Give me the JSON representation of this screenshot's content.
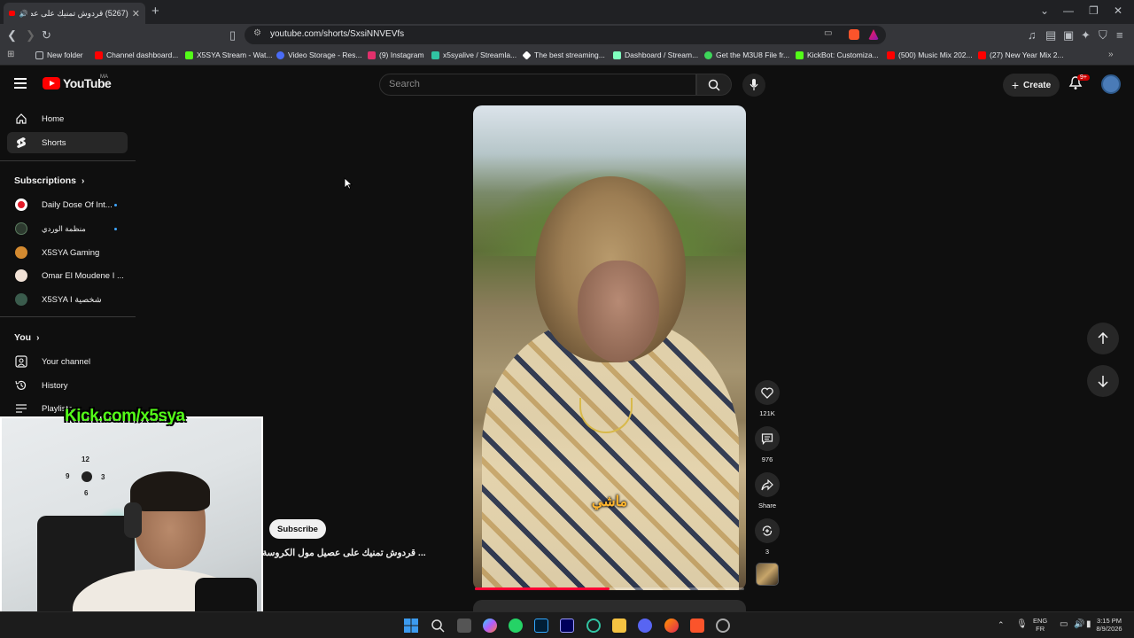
{
  "browser": {
    "tab_title": "(5267) قردوش تمنيك على عصـ",
    "new_tab": "+",
    "url": "youtube.com/shorts/SxsiNNVEVfs",
    "window_controls": [
      "⌄",
      "—",
      "❐",
      "✕"
    ],
    "bookmarks": [
      {
        "label": "New folder",
        "icon": "folder-icon",
        "color": "#bdc1c6"
      },
      {
        "label": "Channel dashboard...",
        "icon": "youtube-icon",
        "color": "#ff0000"
      },
      {
        "label": "X5SYA Stream - Wat...",
        "icon": "kick-icon",
        "color": "#53fc18"
      },
      {
        "label": "Video Storage - Res...",
        "icon": "storage-icon",
        "color": "#4a6cf7"
      },
      {
        "label": "(9) Instagram",
        "icon": "instagram-icon",
        "color": "#e1306c"
      },
      {
        "label": "x5syalive / Streamla...",
        "icon": "streamlabs-icon",
        "color": "#31c3a2"
      },
      {
        "label": "The best streaming...",
        "icon": "diamond-icon",
        "color": "#ffffff"
      },
      {
        "label": "Dashboard / Stream...",
        "icon": "dashboard-icon",
        "color": "#80ffbe"
      },
      {
        "label": "Get the M3U8 File fr...",
        "icon": "green-circle-icon",
        "color": "#3dd65a"
      },
      {
        "label": "KickBot: Customiza...",
        "icon": "kickbot-icon",
        "color": "#53fc18"
      },
      {
        "label": "(500) Music Mix 202...",
        "icon": "youtube-icon",
        "color": "#ff0000"
      },
      {
        "label": "(27) New Year Mix 2...",
        "icon": "youtube-icon",
        "color": "#ff0000"
      }
    ]
  },
  "youtube": {
    "logo_text": "YouTube",
    "country_code": "MA",
    "search_placeholder": "Search",
    "create_label": "Create",
    "notification_count": "9+"
  },
  "sidebar": {
    "nav": [
      {
        "label": "Home",
        "icon": "home-icon"
      },
      {
        "label": "Shorts",
        "icon": "shorts-icon"
      }
    ],
    "subscriptions_heading": "Subscriptions",
    "subscriptions": [
      {
        "label": "Daily Dose Of Int...",
        "color": "#e31c2a",
        "live": true
      },
      {
        "label": "منظمة الوردي",
        "color": "#2d3a2f",
        "live": true
      },
      {
        "label": "X5SYA Gaming",
        "color": "#d38a30",
        "live": false
      },
      {
        "label": "Omar El Moudene I ...",
        "color": "#f1e2d6",
        "live": false
      },
      {
        "label": "X5SYA I شخصية",
        "color": "#3a5b4c",
        "live": false
      }
    ],
    "you_heading": "You",
    "you_items": [
      {
        "label": "Your channel",
        "icon": "channel-icon"
      },
      {
        "label": "History",
        "icon": "history-icon"
      },
      {
        "label": "Playlists",
        "icon": "playlist-icon"
      }
    ]
  },
  "short": {
    "caption_overlay": "ماشي",
    "title": "... قردوش تمنيك على عصيل مول الكروسة",
    "subscribe_label": "Subscribe",
    "progress": 0.5,
    "actions": {
      "likes": "121K",
      "comments": "976",
      "share": "Share",
      "remix": "3"
    }
  },
  "overlay": {
    "kick_banner": "Kick.com/x5sya",
    "clock_numbers": [
      "12",
      "3",
      "6",
      "9"
    ]
  },
  "taskbar": {
    "lang_top": "ENG",
    "lang_bottom": "FR",
    "time": "3:15 PM",
    "date": "8/9/2026"
  }
}
